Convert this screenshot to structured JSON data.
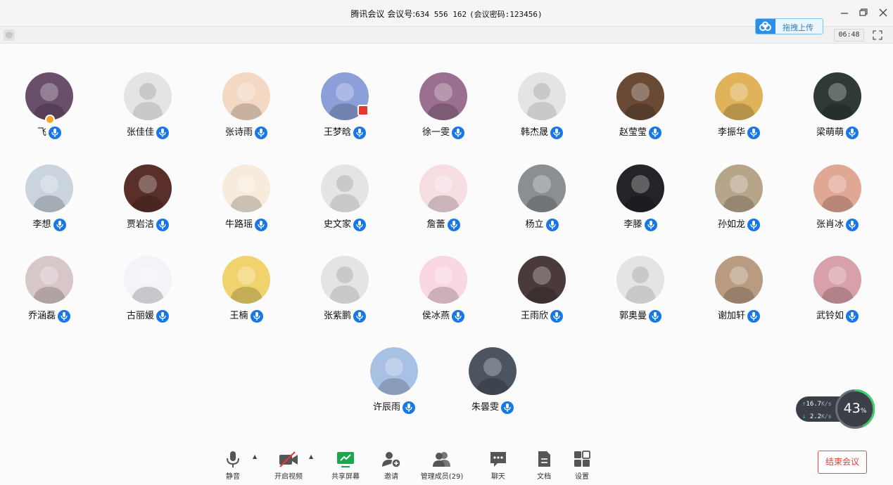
{
  "window": {
    "app_name": "腾讯会议",
    "meeting_id_label": "会议号:",
    "meeting_id": "634 556 162",
    "password_text": "(会议密码:123456)",
    "minimize_icon": "minimize-icon",
    "restore_icon": "restore-icon",
    "close_icon": "close-icon"
  },
  "topbar": {
    "upload_label": "拖拽上传",
    "timer": "06:48"
  },
  "participants": [
    {
      "name": "飞",
      "avatar": "photo",
      "color": "#6a4f6b",
      "host": true
    },
    {
      "name": "张佳佳",
      "avatar": "default"
    },
    {
      "name": "张诗雨",
      "avatar": "photo",
      "color": "#f3d9c3"
    },
    {
      "name": "王梦晗",
      "avatar": "photo",
      "color": "#8c9fd8",
      "flag": true
    },
    {
      "name": "徐一雯",
      "avatar": "photo",
      "color": "#9a6f8f"
    },
    {
      "name": "韩杰晟",
      "avatar": "default"
    },
    {
      "name": "赵莹莹",
      "avatar": "photo",
      "color": "#6a4a35"
    },
    {
      "name": "李振华",
      "avatar": "photo",
      "color": "#e0b35a"
    },
    {
      "name": "梁萌萌",
      "avatar": "photo",
      "color": "#2f3a36"
    },
    {
      "name": "李想",
      "avatar": "photo",
      "color": "#c9d4df"
    },
    {
      "name": "贾岩洁",
      "avatar": "photo",
      "color": "#5a2f2a"
    },
    {
      "name": "牛路瑶",
      "avatar": "photo",
      "color": "#f7ecdc"
    },
    {
      "name": "史文家",
      "avatar": "default"
    },
    {
      "name": "詹蕾",
      "avatar": "photo",
      "color": "#f6dde2"
    },
    {
      "name": "杨立",
      "avatar": "photo",
      "color": "#8a8f94"
    },
    {
      "name": "李滕",
      "avatar": "photo",
      "color": "#222428"
    },
    {
      "name": "孙如龙",
      "avatar": "photo",
      "color": "#b7a58a"
    },
    {
      "name": "张肖冰",
      "avatar": "photo",
      "color": "#e0a795"
    },
    {
      "name": "乔涵磊",
      "avatar": "photo",
      "color": "#d8c7c9"
    },
    {
      "name": "古丽媛",
      "avatar": "photo",
      "color": "#f2f4f8"
    },
    {
      "name": "王楠",
      "avatar": "photo",
      "color": "#f0d36c"
    },
    {
      "name": "张紫鹏",
      "avatar": "default"
    },
    {
      "name": "侯冰燕",
      "avatar": "photo",
      "color": "#f8d7e0"
    },
    {
      "name": "王雨欣",
      "avatar": "photo",
      "color": "#4a3a3a"
    },
    {
      "name": "郭奥曼",
      "avatar": "default"
    },
    {
      "name": "谢加轩",
      "avatar": "photo",
      "color": "#b99b82"
    },
    {
      "name": "武铃如",
      "avatar": "photo",
      "color": "#d8a0a8"
    },
    {
      "name": "许辰雨",
      "avatar": "photo",
      "color": "#a8c0e4"
    },
    {
      "name": "朱曇雯",
      "avatar": "photo",
      "color": "#4c5460"
    }
  ],
  "network": {
    "upload_speed": "16.7",
    "download_speed": "2.2",
    "unit": "K/s",
    "cpu_percent": 43,
    "cpu_percent_label": "43",
    "percent_sign": "%"
  },
  "toolbar": {
    "mute": "静音",
    "video": "开启视频",
    "share": "共享屏幕",
    "invite": "邀请",
    "members": "管理成员(29)",
    "chat": "聊天",
    "docs": "文档",
    "settings": "设置",
    "end": "结束会议"
  },
  "colors": {
    "mic_blue": "#1877e5",
    "share_green": "#1aa84b",
    "end_red": "#e43a3a"
  }
}
